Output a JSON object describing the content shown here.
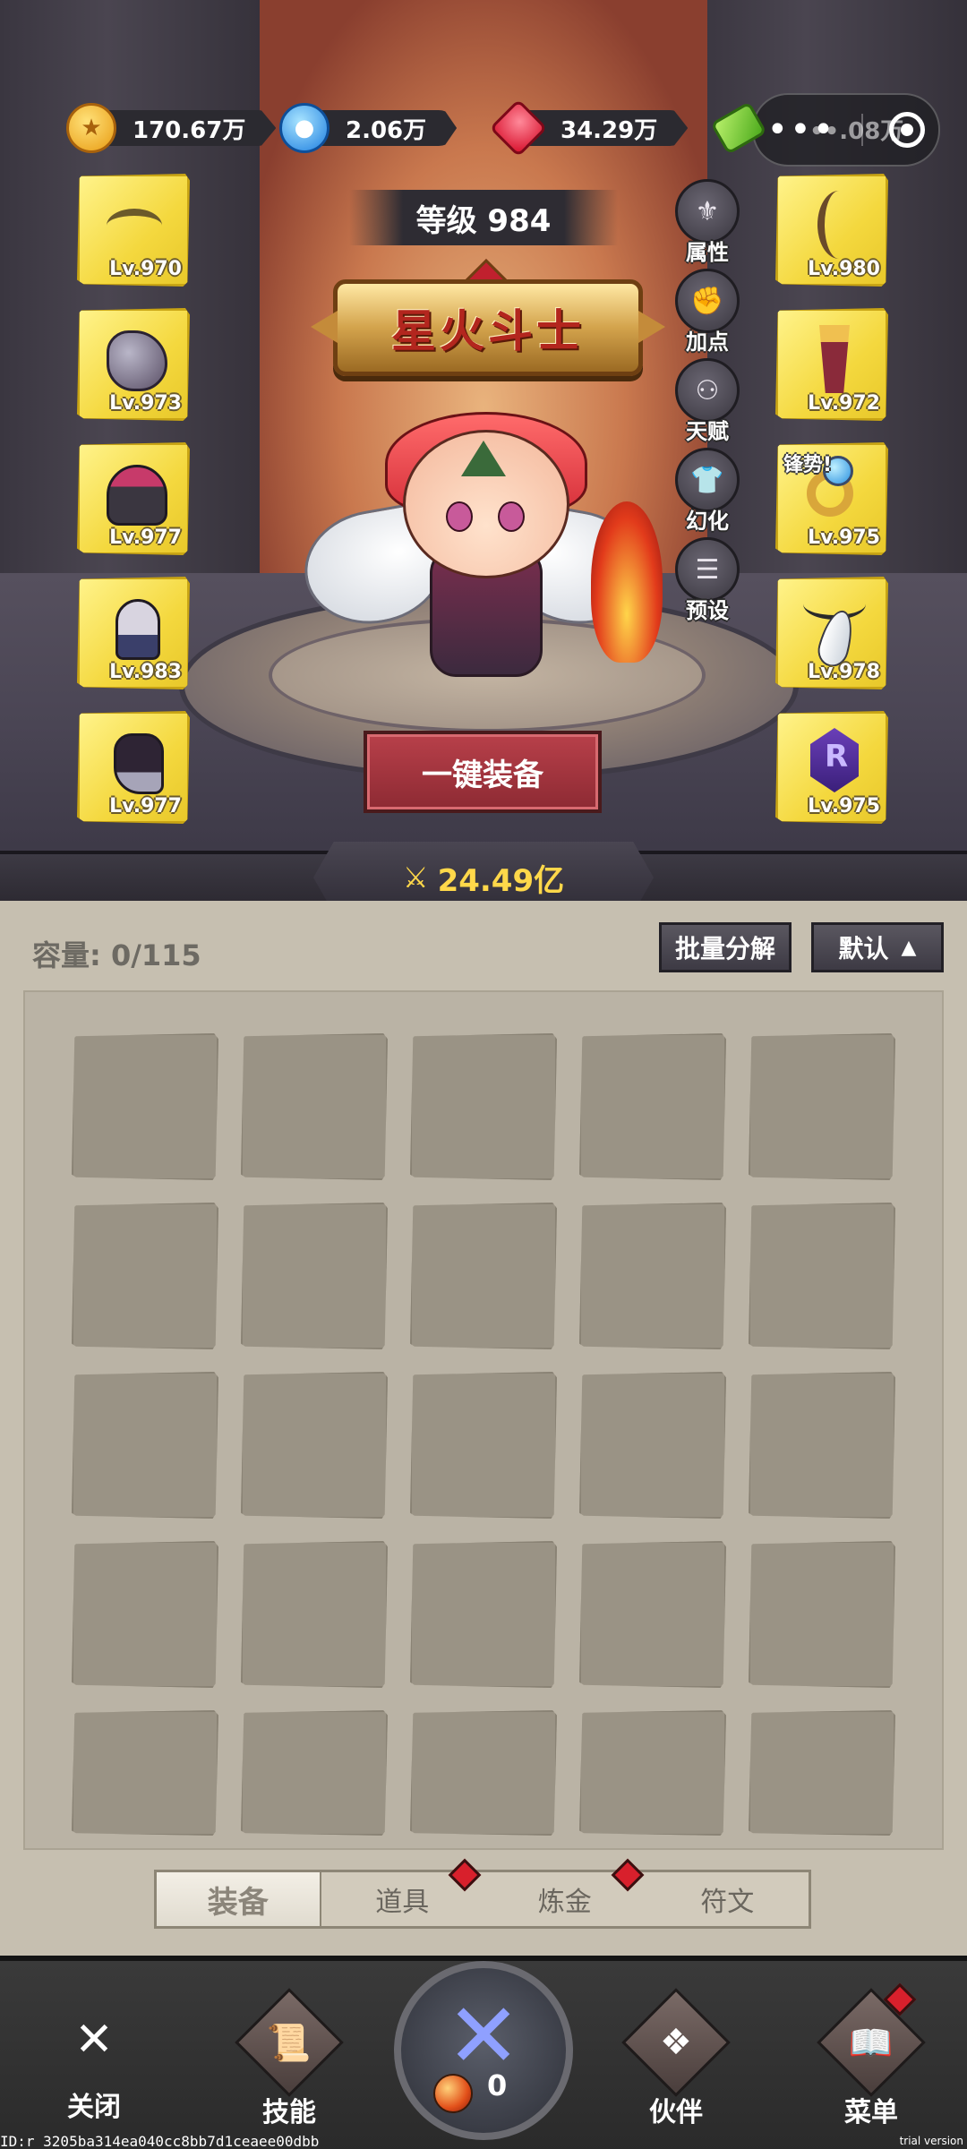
{
  "currencies": [
    {
      "icon": "gold-coin-icon",
      "value": "170.67万"
    },
    {
      "icon": "blue-crystal-icon",
      "value": "2.06万"
    },
    {
      "icon": "ruby-gem-icon",
      "value": "34.29万"
    },
    {
      "icon": "green-cash-icon",
      "value": "••.08万"
    }
  ],
  "capsule": {
    "dots": "•••",
    "overlay": "••.08万"
  },
  "level_label": "等级 984",
  "title_plaque": "星火斗士",
  "left_slots": [
    {
      "item": "antler-helm-icon",
      "level": "Lv.970"
    },
    {
      "item": "shoulder-armor-icon",
      "level": "Lv.973"
    },
    {
      "item": "chest-armor-icon",
      "level": "Lv.977"
    },
    {
      "item": "gauntlet-icon",
      "level": "Lv.983"
    },
    {
      "item": "boots-icon",
      "level": "Lv.977"
    }
  ],
  "right_slots": [
    {
      "item": "bow-icon",
      "level": "Lv.980",
      "tag": ""
    },
    {
      "item": "quiver-icon",
      "level": "Lv.972",
      "tag": ""
    },
    {
      "item": "ring-icon",
      "level": "Lv.975",
      "tag": "锋势!"
    },
    {
      "item": "feather-necklace-icon",
      "level": "Lv.978",
      "tag": ""
    },
    {
      "item": "rune-icon",
      "level": "Lv.975",
      "tag": ""
    }
  ],
  "rune_letter": "R",
  "side_buttons": [
    {
      "icon": "attributes-icon",
      "label": "属性"
    },
    {
      "icon": "add-points-icon",
      "label": "加点"
    },
    {
      "icon": "talent-tree-icon",
      "label": "天赋"
    },
    {
      "icon": "transmog-icon",
      "label": "幻化"
    },
    {
      "icon": "preset-icon",
      "label": "预设"
    }
  ],
  "equip_all_label": "一键装备",
  "power_value": "24.49亿",
  "power_icon": "crossed-swords-icon",
  "inventory": {
    "capacity_label": "容量: 0/115",
    "batch_decompose_label": "批量分解",
    "sort_label": "默认",
    "sort_icon": "chevron-up-icon"
  },
  "tabs": [
    {
      "label": "装备",
      "active": true,
      "dot": false
    },
    {
      "label": "道具",
      "active": false,
      "dot": true
    },
    {
      "label": "炼金",
      "active": false,
      "dot": true
    },
    {
      "label": "符文",
      "active": false,
      "dot": false
    }
  ],
  "nav": {
    "close": {
      "label": "关闭",
      "icon": "close-crossed-swords-icon"
    },
    "skills": {
      "label": "技能",
      "icon": "skill-scroll-icon"
    },
    "battle": {
      "icon": "battle-swords-icon",
      "count": "0"
    },
    "partner": {
      "label": "伙伴",
      "icon": "partner-wings-icon"
    },
    "menu": {
      "label": "菜单",
      "icon": "menu-book-icon"
    }
  },
  "debug_id": "ID:r_3205ba314ea040cc8bb7d1ceaee00dbb",
  "trial_label": "trial version",
  "colors": {
    "accent_gold": "#f4d83e",
    "power_text": "#ffd84a",
    "equip_button": "#8d2a33",
    "panel_bg": "#c6bfb0",
    "red_dot": "#d8202c"
  }
}
